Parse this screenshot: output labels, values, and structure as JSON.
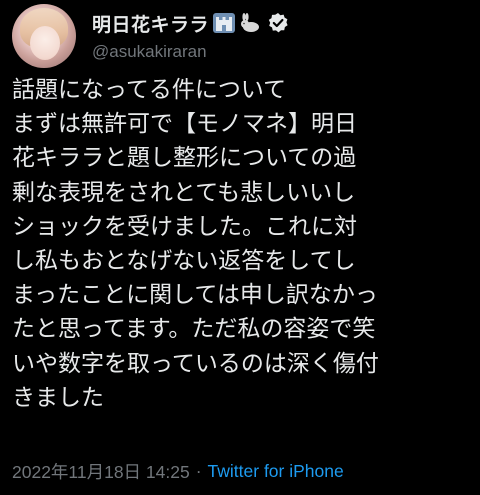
{
  "author": {
    "display_name": "明日花キララ",
    "handle": "@asukakiraran",
    "name_emojis": [
      "castle-icon",
      "rabbit-icon"
    ],
    "verified": true
  },
  "tweet": {
    "lines": [
      "話題になってる件について",
      "まずは無許可で【モノマネ】明日",
      "花キララと題し整形についての過",
      "剰な表現をされとても悲しいいし",
      "ショックを受けました。これに対",
      "し私もおとなげない返答をしてし",
      "まったことに関しては申し訳なかっ",
      "たと思ってます。ただ私の容姿で笑",
      "いや数字を取っているのは深く傷付",
      "きました"
    ]
  },
  "meta": {
    "timestamp": "2022年11月18日 14:25",
    "separator": "·",
    "source": "Twitter for iPhone"
  },
  "colors": {
    "background": "#000000",
    "text": "#e7e9ea",
    "secondary": "#71767b",
    "accent": "#1d9bf0"
  }
}
